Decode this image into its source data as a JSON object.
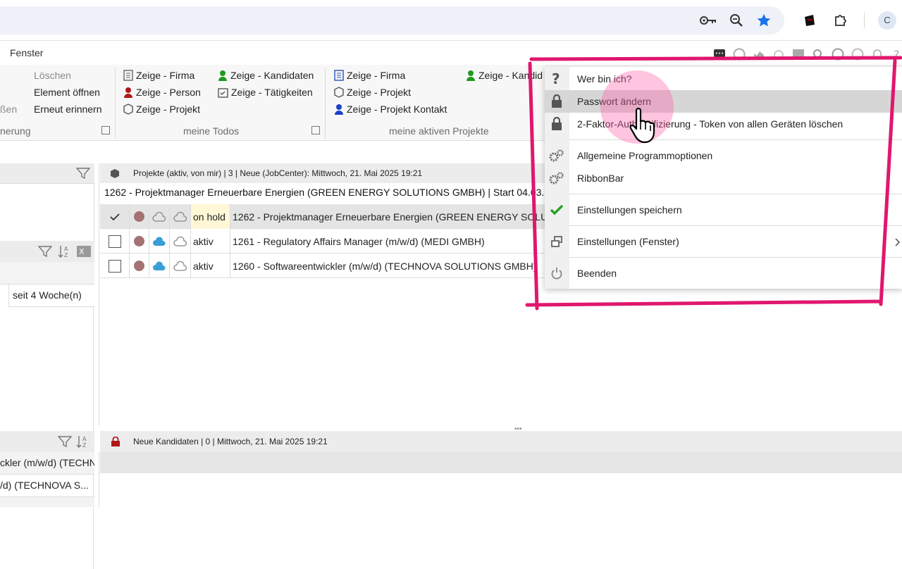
{
  "browser": {
    "icons": [
      "key-icon",
      "zoom-icon",
      "bookmark-star-icon",
      "extension-icon",
      "puzzle-icon"
    ],
    "avatar_letter": "C"
  },
  "menu": {
    "fenster": "Fenster"
  },
  "ribbon": {
    "col1": {
      "loeschen": "Löschen",
      "element_oeffnen": "Element öffnen",
      "erneut_erinnern": "Erneut erinnern",
      "sschliessen": "ßen",
      "group_partial": "nerung"
    },
    "col2": {
      "firma": "Zeige - Firma",
      "person": "Zeige - Person",
      "projekt": "Zeige - Projekt"
    },
    "col3": {
      "kandidaten": "Zeige - Kandidaten",
      "taetigkeiten": "Zeige - Tätigkeiten",
      "group_label": "meine Todos"
    },
    "col4": {
      "firma": "Zeige - Firma",
      "projekt": "Zeige - Projekt",
      "projekt_kontakt": "Zeige - Projekt Kontakt",
      "group_label": "meine aktiven Projekte"
    },
    "col5": {
      "kandidaten_partial": "Zeige - Kandid"
    }
  },
  "left": {
    "cell": "seit 4 Woche(n)"
  },
  "projects": {
    "header": "Projekte (aktiv, von mir) | 3 | Neue (JobCenter): Mittwoch, 21. Mai 2025 19:21",
    "title": "1262 - Projektmanager Erneuerbare Energien (GREEN ENERGY SOLUTIONS GMBH) | Start 04.03.",
    "rows": [
      {
        "status": "on hold",
        "name": "1262 - Projektmanager Erneuerbare Energien (GREEN ENERGY SOLU"
      },
      {
        "status": "aktiv",
        "name": "1261 - Regulatory Affairs Manager (m/w/d) (MEDI GMBH)"
      },
      {
        "status": "aktiv",
        "name": "1260 - Softwareentwickler (m/w/d) (TECHNOVA SOLUTIONS GMBH)"
      }
    ]
  },
  "bottom": {
    "header": "Neue Kandidaten | 0 | Mittwoch, 21. Mai 2025 19:21",
    "left_rows": [
      "ckler (m/w/d) (TECHN",
      "/d) (TECHNOVA S..."
    ]
  },
  "dropdown": {
    "items": [
      {
        "label": "Wer bin ich?",
        "icon": "question-icon"
      },
      {
        "label": "Passwort ändern",
        "icon": "lock-icon"
      },
      {
        "label": "2-Faktor-Authentifizierung - Token von allen Geräten löschen",
        "icon": "lock-icon"
      },
      {
        "label": "Allgemeine Programmoptionen",
        "icon": "gears-icon"
      },
      {
        "label": "RibbonBar",
        "icon": "gears-icon"
      },
      {
        "label": "Einstellungen speichern",
        "icon": "checkmark-icon"
      },
      {
        "label": "Einstellungen (Fenster)",
        "icon": "windows-icon"
      },
      {
        "label": "Beenden",
        "icon": "power-icon"
      }
    ]
  },
  "colors": {
    "annotation": "#e0176e",
    "status_dot": "#a37272",
    "checkmark": "#2aa12a",
    "star": "#1a73e8"
  }
}
